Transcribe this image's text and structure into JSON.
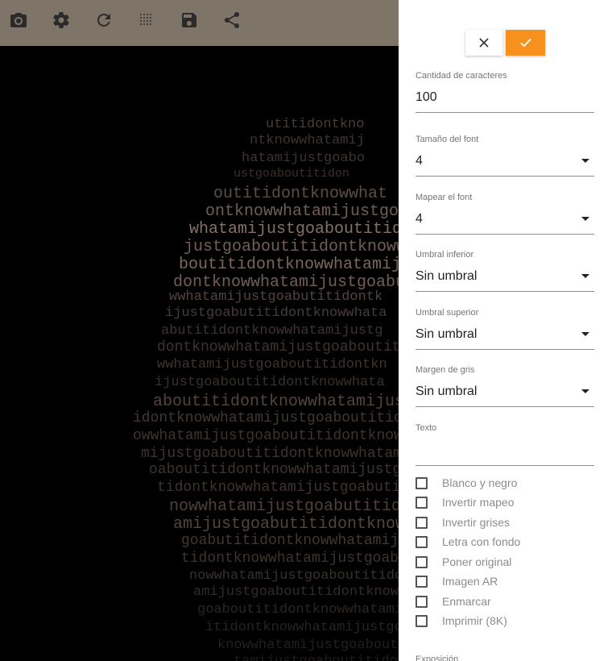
{
  "toolbar": {
    "icons": [
      "camera-icon",
      "gear-icon",
      "refresh-icon",
      "grid-icon",
      "save-icon",
      "share-icon"
    ]
  },
  "canvas": {
    "ascii_text": "utitidontknowwhatamijustgoaboutitidontknowwhatamijustgoaboutitidontknowwhatamijustgoab"
  },
  "panel": {
    "cancel_icon": "close-icon",
    "confirm_icon": "check-icon",
    "confirm_color": "#f7911e",
    "fields": [
      {
        "label": "Cantidad de caracteres",
        "value": "100"
      },
      {
        "label": "Tamaño del font",
        "value": "4"
      },
      {
        "label": "Mapear el font",
        "value": "4"
      },
      {
        "label": "Umbral inferior",
        "value": "Sin umbral"
      },
      {
        "label": "Umbral superior",
        "value": "Sin umbral"
      },
      {
        "label": "Margen de gris",
        "value": "Sin umbral"
      },
      {
        "label": "Texto",
        "value": ""
      }
    ],
    "checkboxes": [
      {
        "label": "Blanco y negro",
        "checked": false
      },
      {
        "label": "Invertir mapeo",
        "checked": false
      },
      {
        "label": "Invertir grises",
        "checked": false
      },
      {
        "label": "Letra con fondo",
        "checked": false
      },
      {
        "label": "Poner original",
        "checked": false
      },
      {
        "label": "Imagen AR",
        "checked": false
      },
      {
        "label": "Enmarcar",
        "checked": false
      },
      {
        "label": "Imprimir (8K)",
        "checked": false
      }
    ],
    "exposure_label": "Exposición"
  }
}
